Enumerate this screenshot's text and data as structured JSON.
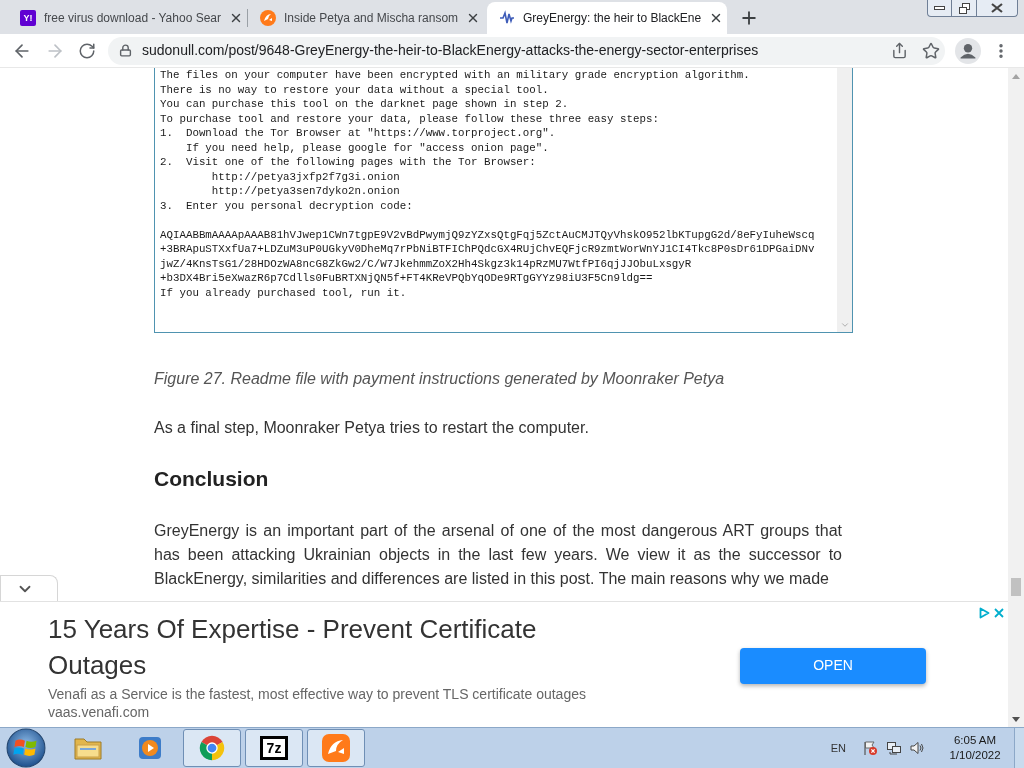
{
  "browser": {
    "tabs": [
      {
        "title": "free virus download - Yahoo Sear",
        "selected": false,
        "favicon": {
          "kind": "text",
          "text": "Y!"
        }
      },
      {
        "title": "Inside Petya and Mischa ransom",
        "selected": false,
        "favicon": {
          "kind": "disc"
        }
      },
      {
        "title": "GreyEnergy: the heir to BlackEne",
        "selected": true,
        "favicon": {
          "kind": "wave"
        }
      }
    ],
    "toolbar": {
      "forward_disabled": true,
      "url": "sudonull.com/post/9648-GreyEnergy-the-heir-to-BlackEnergy-attacks-the-energy-sector-enterprises"
    }
  },
  "article": {
    "readme_box": {
      "instructions": [
        "The files on your computer have been encrypted with an military grade encryption algorithm.",
        "There is no way to restore your data without a special tool.",
        "You can purchase this tool on the darknet page shown in step 2.",
        "To purchase tool and restore your data, please follow these three easy steps:",
        "1.\tDownload the Tor Browser at \"https://www.torproject.org\".",
        "\tIf you need help, please google for \"access onion page\".",
        "2.\tVisit one of the following pages with the Tor Browser:",
        "\t\thttp://petya3jxfp2f7g3i.onion",
        "\t\thttp://petya3sen7dyko2n.onion",
        "3.\tEnter you personal decryption code:"
      ],
      "decryption_code": [
        "AQIAABBmAAAApAAAB81hVJwep1CWn7tgpE9V2vBdPwymjQ9zYZxsQtgFqj5ZctAuCMJTQyVhskO952lbKTupgG2d/8eFyIuheWscq",
        "+3BRApuSTXxfUa7+LDZuM3uP0UGkyV0DheMq7rPbNiBTFIChPQdcGX4RUjChvEQFjcR9zmtWorWnYJ1CI4Tkc8P0sDr61DPGaiDNv",
        "jwZ/4KnsTsG1/28HDOzWA8ncG8ZkGw2/C/W7JkehmmZoX2Hh4Skgz3k14pRzMU7WtfPI6qjJJObuLxsgyR",
        "+b3DX4Bri5eXwazR6p7Cdlls0FuBRTXNjQN5f+FT4KReVPQbYqODe9RTgGYYz98iU3F5Cn9ldg=="
      ],
      "closing": "If you already purchased tool, run it."
    },
    "figure_caption": "Figure 27. Readme file with payment instructions generated by Moonraker Petya",
    "paragraph": "As a final step, Moonraker Petya tries to restart the computer.",
    "heading": "Conclusion",
    "conclusion_paragraph": "GreyEnergy is an important part of the arsenal of one of the most dangerous ART groups that has been attacking Ukrainian objects in the last few years. We view it as the successor to BlackEnergy, similarities and differences are listed in this post. The main reasons why we made"
  },
  "ad": {
    "title": "15 Years Of Expertise - Prevent Certificate Outages",
    "description": "Venafi as a Service is the fastest, most effective way to prevent TLS certificate outages",
    "url": "vaas.venafi.com",
    "button": "OPEN"
  },
  "taskbar": {
    "apps": [
      {
        "kind": "folder",
        "running": false
      },
      {
        "kind": "player",
        "running": false
      },
      {
        "kind": "browser",
        "running": true
      },
      {
        "kind": "text-tile",
        "text": "7z",
        "running": true
      },
      {
        "kind": "disc",
        "running": true
      }
    ],
    "language": "EN",
    "time": "6:05 AM",
    "date": "1/10/2022"
  }
}
